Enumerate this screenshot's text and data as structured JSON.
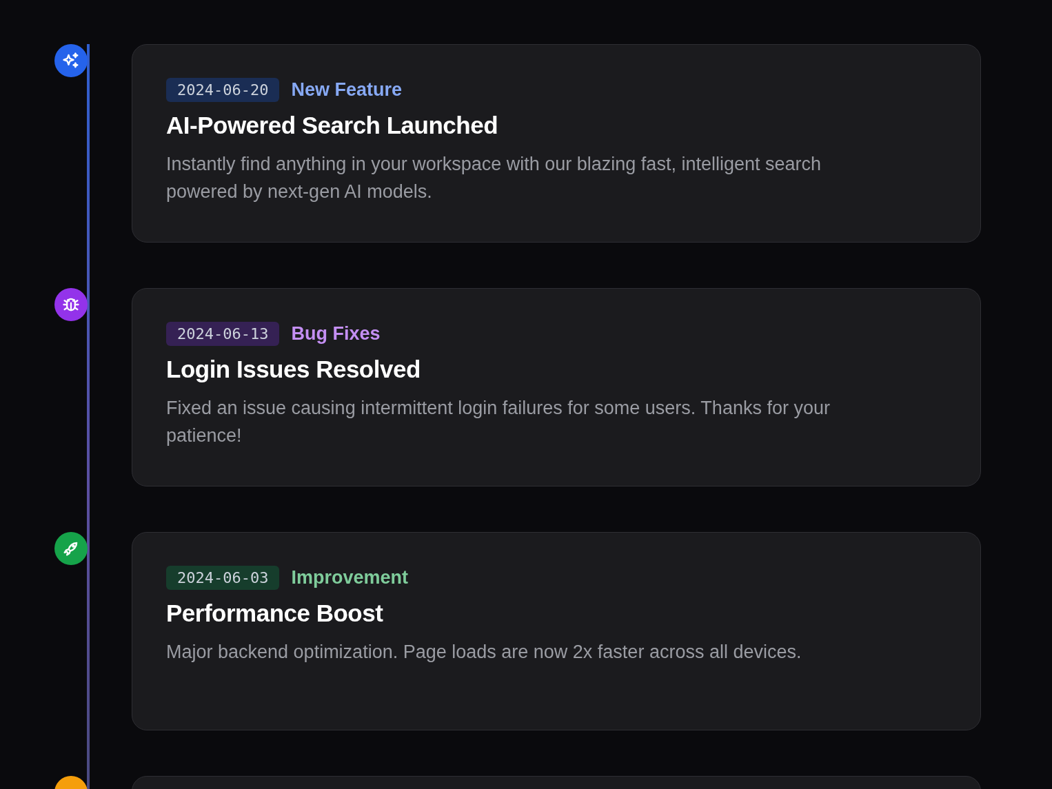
{
  "timeline": [
    {
      "kind": "feature",
      "color": "#2563eb",
      "date": "2024-06-20",
      "tag": "New Feature",
      "title": "AI-Powered Search Launched",
      "description": "Instantly find anything in your workspace with our blazing fast, intelligent search powered by next-gen AI models."
    },
    {
      "kind": "bugfix",
      "color": "#9333ea",
      "date": "2024-06-13",
      "tag": "Bug Fixes",
      "title": "Login Issues Resolved",
      "description": "Fixed an issue causing intermittent login failures for some users. Thanks for your patience!"
    },
    {
      "kind": "improvement",
      "color": "#16a34a",
      "date": "2024-06-03",
      "tag": "Improvement",
      "title": "Performance Boost",
      "description": "Major backend optimization. Page loads are now 2x faster across all devices."
    },
    {
      "kind": "other",
      "color": "#f59e0b"
    }
  ]
}
